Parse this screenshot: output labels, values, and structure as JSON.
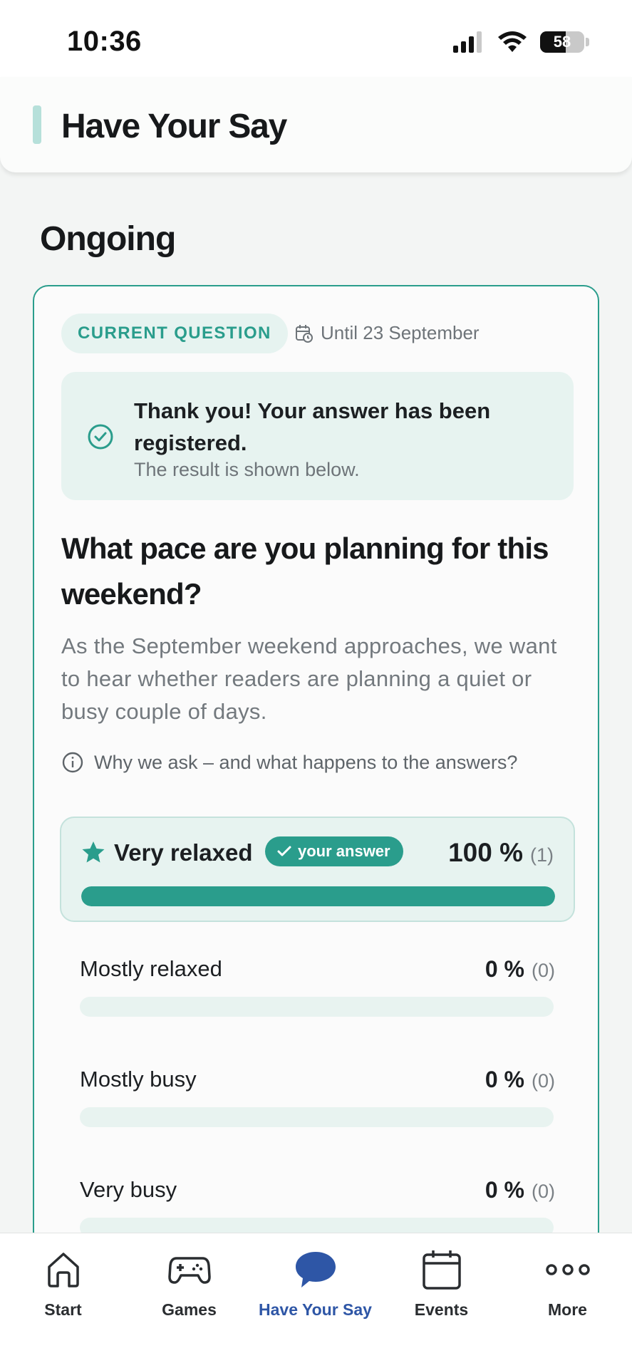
{
  "status_bar": {
    "time": "10:36",
    "battery": "58"
  },
  "header": {
    "title": "Have Your Say"
  },
  "section": {
    "title": "Ongoing"
  },
  "card": {
    "tag": "CURRENT QUESTION",
    "deadline": "Until 23 September",
    "notice": {
      "title": "Thank you! Your answer has been registered.",
      "subtitle": "The result is shown below."
    },
    "question": "What pace are you planning for this weekend?",
    "description": "As the September weekend approaches, we want to hear whether readers are planning a quiet or busy couple of days.",
    "why_link": "Why we ask – and what happens to the answers?",
    "your_answer_badge": "your answer",
    "options": [
      {
        "label": "Very relaxed",
        "percent": "100 %",
        "count": "(1)",
        "fraction": 1.0,
        "selected": true
      },
      {
        "label": "Mostly relaxed",
        "percent": "0 %",
        "count": "(0)",
        "fraction": 0.0,
        "selected": false
      },
      {
        "label": "Mostly busy",
        "percent": "0 %",
        "count": "(0)",
        "fraction": 0.0,
        "selected": false
      },
      {
        "label": "Very busy",
        "percent": "0 %",
        "count": "(0)",
        "fraction": 0.0,
        "selected": false
      }
    ]
  },
  "bottom_nav": {
    "items": [
      {
        "label": "Start",
        "icon": "home-icon",
        "active": false
      },
      {
        "label": "Games",
        "icon": "gamepad-icon",
        "active": false
      },
      {
        "label": "Have Your Say",
        "icon": "chat-bubble-icon",
        "active": true
      },
      {
        "label": "Events",
        "icon": "calendar-icon",
        "active": false
      },
      {
        "label": "More",
        "icon": "more-dots-icon",
        "active": false
      }
    ]
  },
  "colors": {
    "accent": "#2a9d8c",
    "accent_light": "#e7f3f0",
    "nav_active": "#2e56a6"
  }
}
